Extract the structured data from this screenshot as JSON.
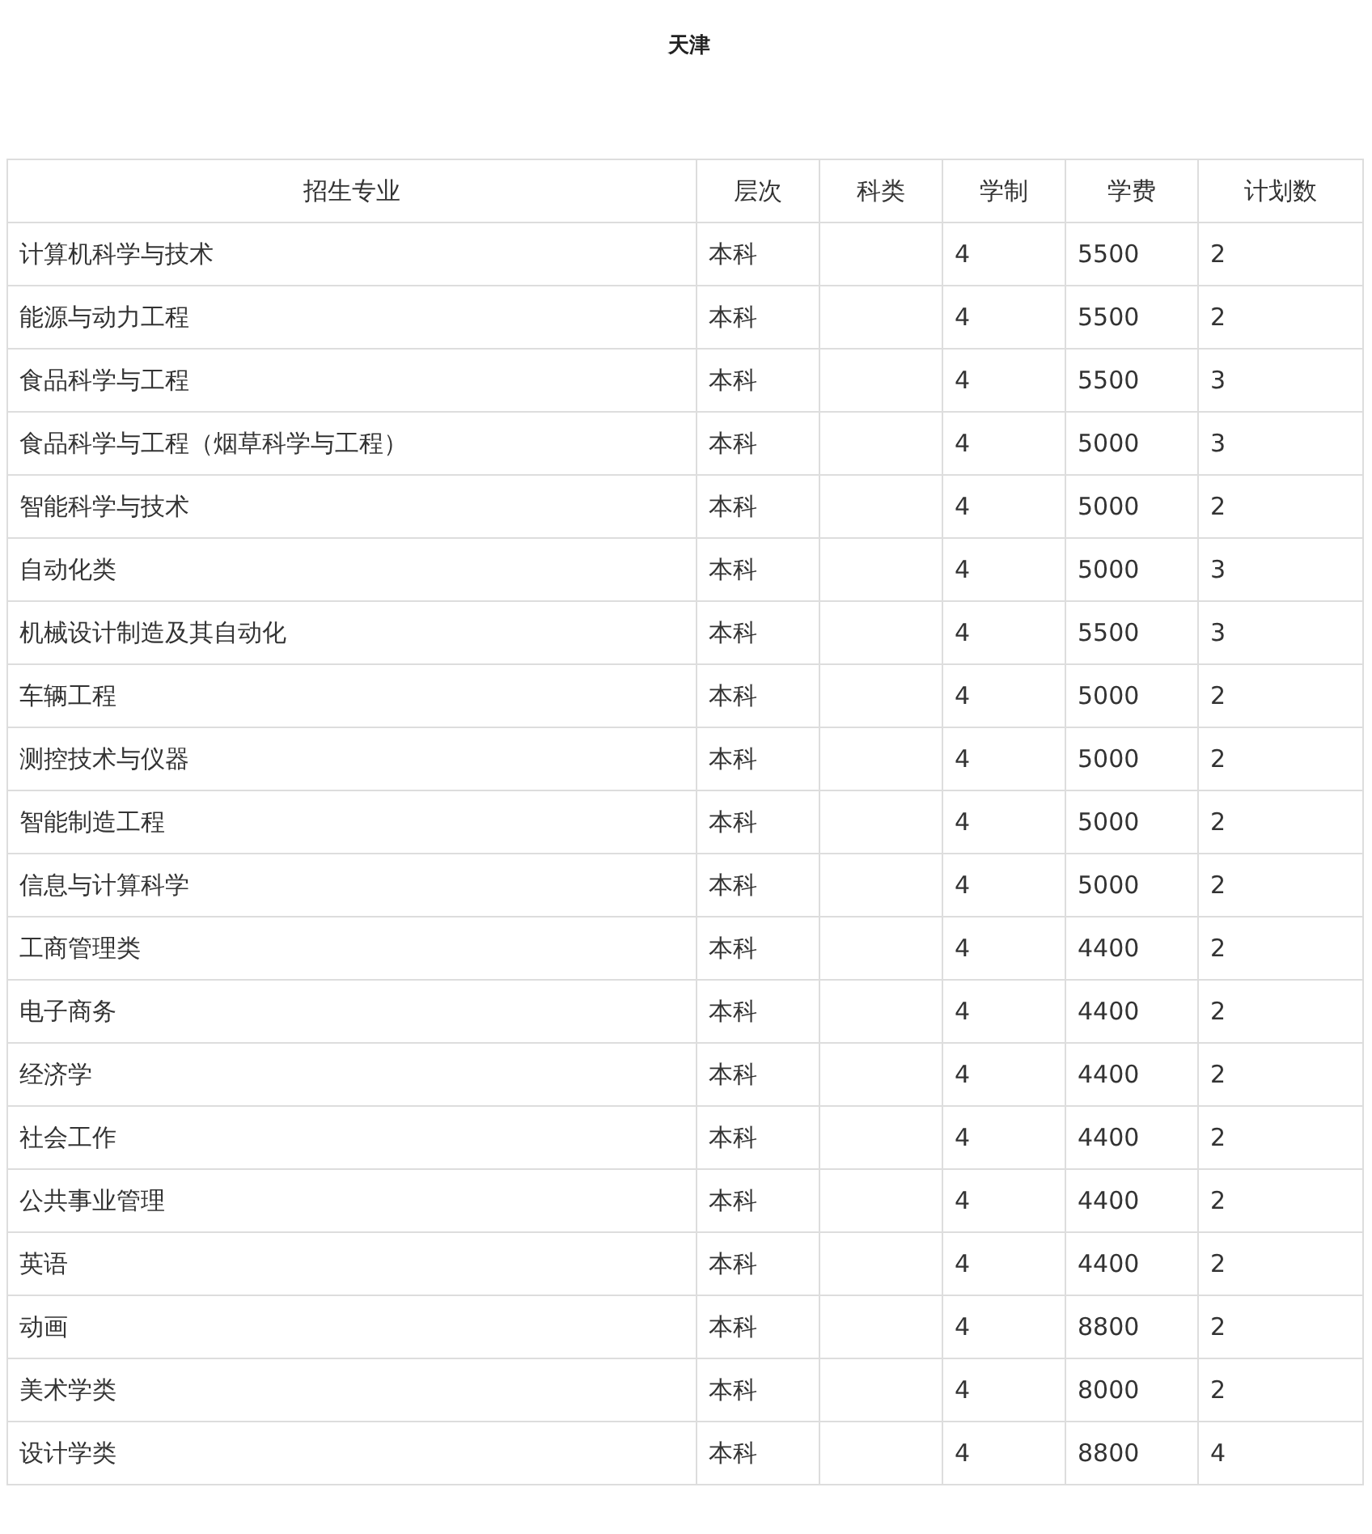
{
  "title": "天津",
  "table": {
    "columns": [
      "招生专业",
      "层次",
      "科类",
      "学制",
      "学费",
      "计划数"
    ],
    "rows": [
      {
        "major": "计算机科学与技术",
        "level": "本科",
        "years": "4",
        "fee": "5500",
        "plan": "2"
      },
      {
        "major": "能源与动力工程",
        "level": "本科",
        "years": "4",
        "fee": "5500",
        "plan": "2"
      },
      {
        "major": "食品科学与工程",
        "level": "本科",
        "years": "4",
        "fee": "5500",
        "plan": "3"
      },
      {
        "major": "食品科学与工程（烟草科学与工程）",
        "level": "本科",
        "years": "4",
        "fee": "5000",
        "plan": "3"
      },
      {
        "major": "智能科学与技术",
        "level": "本科",
        "years": "4",
        "fee": "5000",
        "plan": "2"
      },
      {
        "major": "自动化类",
        "level": "本科",
        "years": "4",
        "fee": "5000",
        "plan": "3"
      },
      {
        "major": "机械设计制造及其自动化",
        "level": "本科",
        "years": "4",
        "fee": "5500",
        "plan": "3"
      },
      {
        "major": "车辆工程",
        "level": "本科",
        "years": "4",
        "fee": "5000",
        "plan": "2"
      },
      {
        "major": "测控技术与仪器",
        "level": "本科",
        "years": "4",
        "fee": "5000",
        "plan": "2"
      },
      {
        "major": "智能制造工程",
        "level": "本科",
        "years": "4",
        "fee": "5000",
        "plan": "2"
      },
      {
        "major": "信息与计算科学",
        "level": "本科",
        "years": "4",
        "fee": "5000",
        "plan": "2"
      },
      {
        "major": "工商管理类",
        "level": "本科",
        "years": "4",
        "fee": "4400",
        "plan": "2"
      },
      {
        "major": "电子商务",
        "level": "本科",
        "years": "4",
        "fee": "4400",
        "plan": "2"
      },
      {
        "major": "经济学",
        "level": "本科",
        "years": "4",
        "fee": "4400",
        "plan": "2"
      },
      {
        "major": "社会工作",
        "level": "本科",
        "years": "4",
        "fee": "4400",
        "plan": "2"
      },
      {
        "major": "公共事业管理",
        "level": "本科",
        "years": "4",
        "fee": "4400",
        "plan": "2"
      },
      {
        "major": "英语",
        "level": "本科",
        "years": "4",
        "fee": "4400",
        "plan": "2"
      },
      {
        "major": "动画",
        "level": "本科",
        "years": "4",
        "fee": "8800",
        "plan": "2"
      },
      {
        "major": "美术学类",
        "level": "本科",
        "years": "4",
        "fee": "8000",
        "plan": "2"
      },
      {
        "major": "设计学类",
        "level": "本科",
        "years": "4",
        "fee": "8800",
        "plan": "4"
      }
    ]
  }
}
